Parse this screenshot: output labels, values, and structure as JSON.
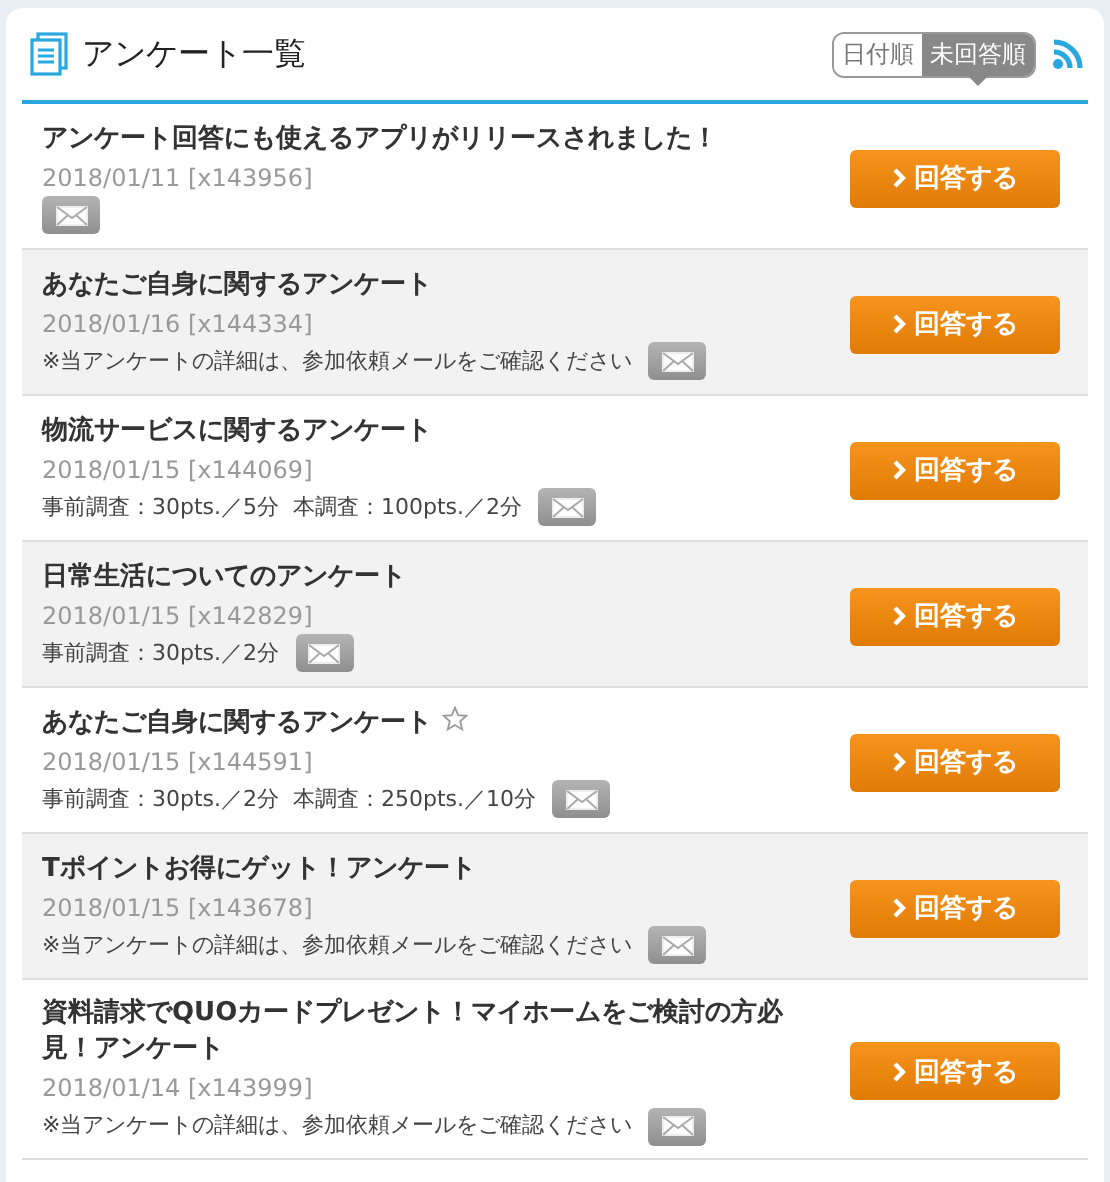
{
  "header": {
    "title": "アンケート一覧",
    "sort_tabs": [
      {
        "label": "日付順",
        "selected": false
      },
      {
        "label": "未回答順",
        "selected": true
      }
    ]
  },
  "surveys": [
    {
      "title": "アンケート回答にも使えるアプリがリリースされました！",
      "starred": false,
      "meta": "2018/01/11 [x143956]",
      "button": "回答する"
    },
    {
      "title": "あなたご自身に関するアンケート",
      "starred": false,
      "meta": "2018/01/16 [x144334]",
      "note": "※当アンケートの詳細は、参加依頼メールをご確認ください",
      "button": "回答する"
    },
    {
      "title": "物流サービスに関するアンケート",
      "starred": false,
      "meta": "2018/01/15 [x144069]",
      "note": "事前調査：30pts.／5分  本調査：100pts.／2分",
      "button": "回答する"
    },
    {
      "title": "日常生活についてのアンケート",
      "starred": false,
      "meta": "2018/01/15 [x142829]",
      "note": "事前調査：30pts.／2分",
      "button": "回答する"
    },
    {
      "title": "あなたご自身に関するアンケート",
      "starred": true,
      "meta": "2018/01/15 [x144591]",
      "note": "事前調査：30pts.／2分  本調査：250pts.／10分",
      "button": "回答する"
    },
    {
      "title": "Tポイントお得にゲット！アンケート",
      "starred": false,
      "meta": "2018/01/15 [x143678]",
      "note": "※当アンケートの詳細は、参加依頼メールをご確認ください",
      "button": "回答する"
    },
    {
      "title": "資料請求でQUOカードプレゼント！マイホームをご検討の方必見！アンケート",
      "starred": false,
      "meta": "2018/01/14 [x143999]",
      "note": "※当アンケートの詳細は、参加依頼メールをご確認ください",
      "button": "回答する"
    }
  ]
}
